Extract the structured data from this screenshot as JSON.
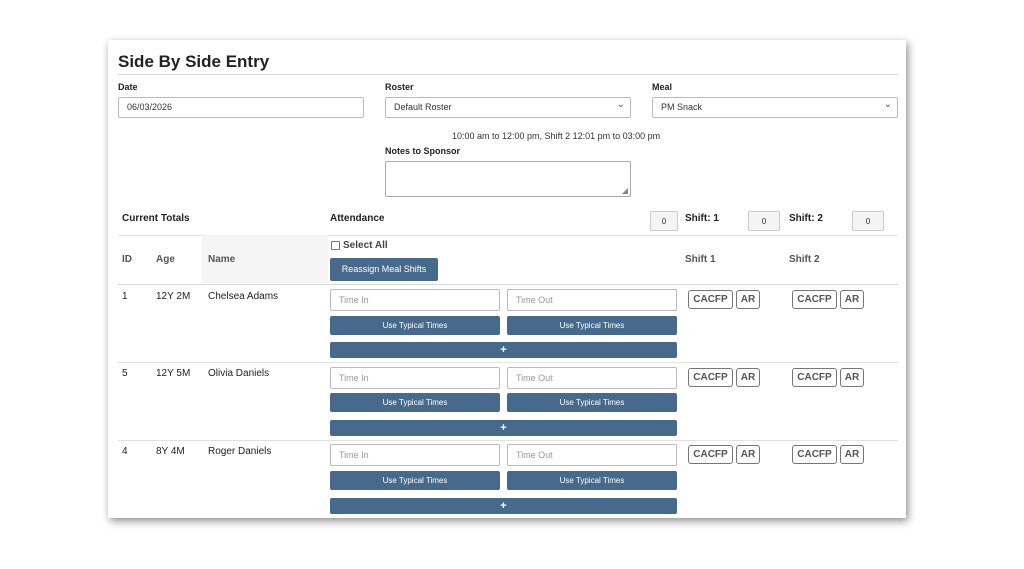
{
  "title": "Side By Side Entry",
  "date": {
    "label": "Date",
    "value": "06/03/2026"
  },
  "roster": {
    "label": "Roster",
    "value": "Default Roster"
  },
  "meal": {
    "label": "Meal",
    "value": "PM Snack"
  },
  "shift_info": "10:00 am to 12:00 pm, Shift 2 12:01 pm to 03:00 pm",
  "notes": {
    "label": "Notes to Sponsor",
    "value": ""
  },
  "totals": {
    "label": "Current Totals",
    "attendance_label": "Attendance",
    "attendance_count": "0",
    "shift1_label": "Shift: 1",
    "shift1_count": "0",
    "shift2_label": "Shift: 2",
    "shift2_count": "0"
  },
  "columns": {
    "id": "ID",
    "age": "Age",
    "name": "Name",
    "shift1": "Shift 1",
    "shift2": "Shift 2"
  },
  "select_all": "Select All",
  "reassign_button": "Reassign Meal Shifts",
  "rows": [
    {
      "id": "1",
      "age": "12Y 2M",
      "name": "Chelsea Adams"
    },
    {
      "id": "5",
      "age": "12Y 5M",
      "name": "Olivia Daniels"
    },
    {
      "id": "4",
      "age": "8Y 4M",
      "name": "Roger Daniels"
    }
  ],
  "row_common": {
    "time_in_placeholder": "Time In",
    "time_out_placeholder": "Time Out",
    "typical_button": "Use Typical Times",
    "add_button": "+",
    "cacfp": "CACFP",
    "ar": "AR"
  },
  "colors": {
    "button": "#47698b",
    "text": "#222222",
    "border": "#bbbbbb"
  }
}
